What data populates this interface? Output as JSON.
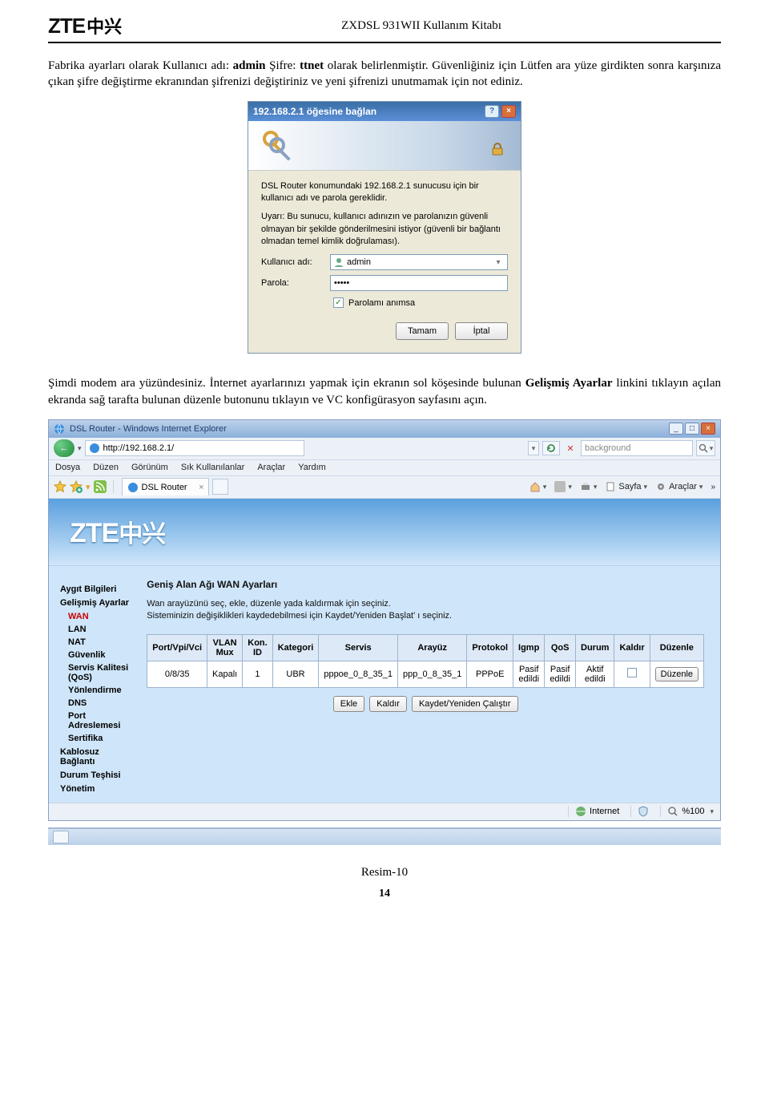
{
  "doc_header": {
    "logo": "ZTE",
    "logo_cn": "中兴",
    "title": "ZXDSL 931WII Kullanım Kitabı"
  },
  "paragraphs": {
    "p1a": "Fabrika ayarları olarak Kullanıcı adı: ",
    "p1_admin": "admin",
    "p1b": " Şifre: ",
    "p1_ttnet": "ttnet",
    "p1c": " olarak belirlenmiştir. Güvenliğiniz için Lütfen ara yüze girdikten sonra karşınıza çıkan şifre değiştirme ekranından şifrenizi değiştiriniz ve yeni şifrenizi unutmamak için not ediniz.",
    "p2a": "Şimdi modem ara yüzündesiniz. İnternet ayarlarınızı yapmak için ekranın sol köşesinde bulunan ",
    "p2_link": "Gelişmiş Ayarlar",
    "p2b": " linkini tıklayın açılan ekranda sağ tarafta bulunan düzenle butonunu tıklayın ve VC konfigürasyon sayfasını açın."
  },
  "dialog": {
    "title": "192.168.2.1 öğesine bağlan",
    "line1": "DSL Router konumundaki 192.168.2.1 sunucusu için bir kullanıcı adı ve parola gereklidir.",
    "line2": "Uyarı: Bu sunucu, kullanıcı adınızın ve parolanızın güvenli olmayan bir şekilde gönderilmesini istiyor (güvenli bir bağlantı olmadan temel kimlik doğrulaması).",
    "user_label": "Kullanıcı adı:",
    "user_value": "admin",
    "pass_label": "Parola:",
    "pass_value": "•••••",
    "remember": "Parolamı anımsa",
    "ok": "Tamam",
    "cancel": "İptal"
  },
  "browser": {
    "window_title": "DSL Router - Windows Internet Explorer",
    "url": "http://192.168.2.1/",
    "search_placeholder": "background",
    "menu": {
      "file": "Dosya",
      "edit": "Düzen",
      "view": "Görünüm",
      "fav": "Sık Kullanılanlar",
      "tools": "Araçlar",
      "help": "Yardım"
    },
    "tab_label": "DSL Router",
    "cmd": {
      "page": "Sayfa",
      "tools": "Araçlar"
    },
    "banner": {
      "logo": "ZTE",
      "cn": "中兴"
    },
    "sidebar": {
      "items": [
        "Aygıt Bilgileri",
        "Gelişmiş Ayarlar",
        "Kablosuz Bağlantı",
        "Durum Teşhisi",
        "Yönetim"
      ],
      "sub": {
        "wan": "WAN",
        "lan": "LAN",
        "nat": "NAT",
        "sec": "Güvenlik",
        "qos": "Servis Kalitesi (QoS)",
        "route": "Yönlendirme",
        "dns": "DNS",
        "port": "Port Adreslemesi",
        "cert": "Sertifika"
      }
    },
    "content": {
      "title": "Geniş Alan Ağı WAN Ayarları",
      "desc1": "Wan arayüzünü seç, ekle, düzenle yada kaldırmak için seçiniz.",
      "desc2": "Sisteminizin değişiklikleri kaydedebilmesi için Kaydet/Yeniden Başlat' ı seçiniz.",
      "headers": [
        "Port/Vpi/Vci",
        "VLAN Mux",
        "Kon. ID",
        "Kategori",
        "Servis",
        "Arayüz",
        "Protokol",
        "Igmp",
        "QoS",
        "Durum",
        "Kaldır",
        "Düzenle"
      ],
      "row": [
        "0/8/35",
        "Kapalı",
        "1",
        "UBR",
        "pppoe_0_8_35_1",
        "ppp_0_8_35_1",
        "PPPoE",
        "Pasif edildi",
        "Pasif edildi",
        "Aktif edildi",
        "",
        "Düzenle"
      ],
      "buttons": {
        "add": "Ekle",
        "remove": "Kaldır",
        "save": "Kaydet/Yeniden Çalıştır"
      }
    },
    "status": {
      "zone": "Internet",
      "zoom": "%100"
    }
  },
  "caption": "Resim-10",
  "page_num": "14"
}
